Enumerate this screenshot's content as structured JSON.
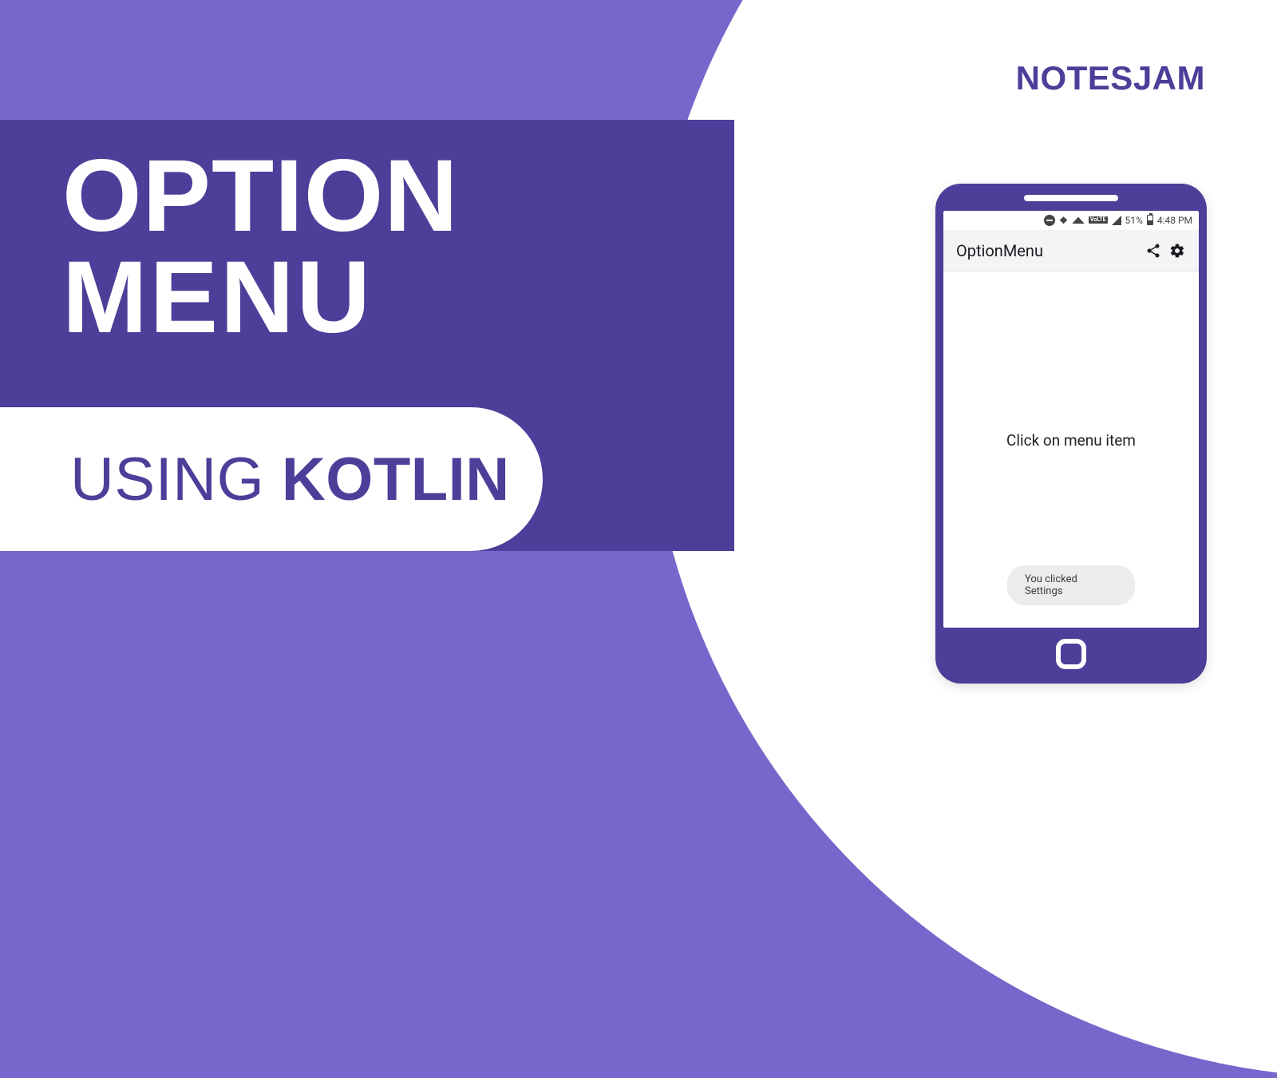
{
  "brand": "NOTESJAM",
  "title_line1": "OPTION",
  "title_line2": "MENU",
  "subtitle_thin": "USING ",
  "subtitle_bold": "KOTLIN",
  "phone": {
    "status": {
      "volte": "VoLTE",
      "bt": "❖",
      "battery_pct": "51%",
      "time": "4:48 PM"
    },
    "appbar": {
      "title": "OptionMenu",
      "actions": {
        "share": "share",
        "settings": "settings"
      }
    },
    "body": {
      "hint": "Click on menu item",
      "toast": "You clicked Settings"
    }
  },
  "colors": {
    "purple": "#7567cb",
    "dark_purple": "#4c3e99"
  }
}
